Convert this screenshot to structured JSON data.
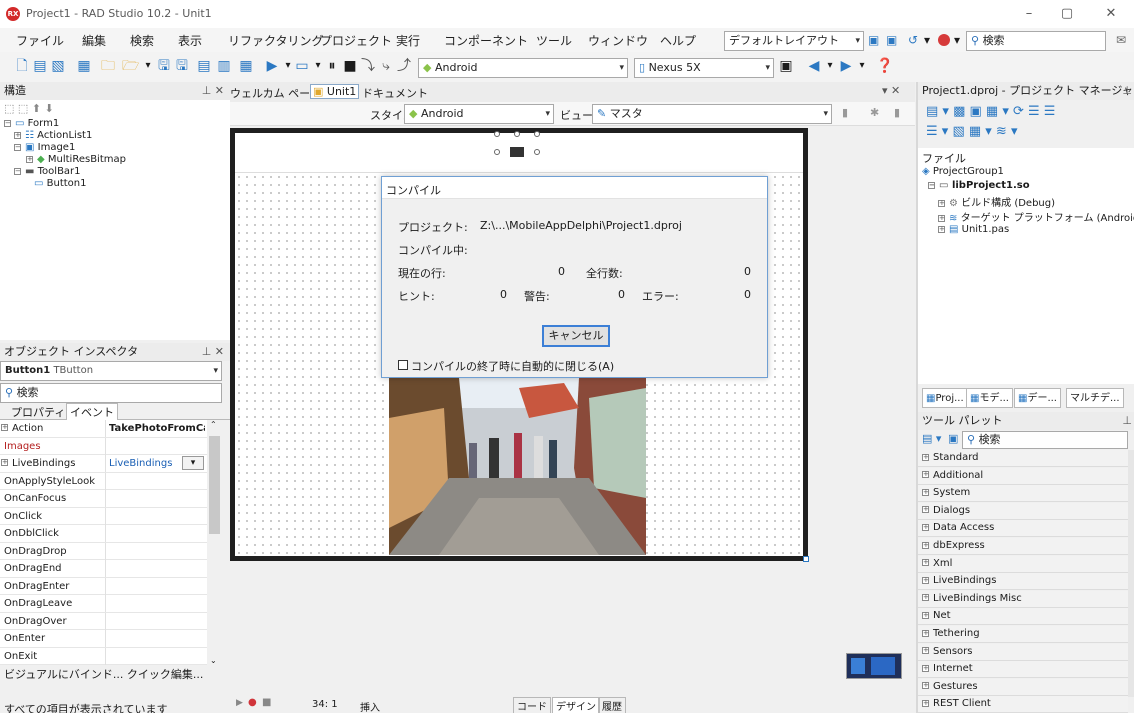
{
  "window": {
    "title": "Project1 - RAD Studio 10.2 - Unit1",
    "app_badge": "RX",
    "controls": {
      "minimize": "–",
      "restore": "▢",
      "close": "✕"
    }
  },
  "menu": {
    "items": [
      "ファイル",
      "編集",
      "検索",
      "表示",
      "リファクタリング",
      "プロジェクト",
      "実行",
      "コンポーネント",
      "ツール",
      "ウィンドウ",
      "ヘルプ"
    ],
    "layout_combo": "デフォルトレイアウト",
    "search_placeholder": "検索"
  },
  "toolbar": {
    "platform_combo": "Android",
    "device_combo": "Nexus 5X"
  },
  "structure": {
    "title": "構造",
    "tree": [
      {
        "label": "Form1",
        "level": 0
      },
      {
        "label": "ActionList1",
        "level": 1
      },
      {
        "label": "Image1",
        "level": 1
      },
      {
        "label": "MultiResBitmap",
        "level": 2
      },
      {
        "label": "ToolBar1",
        "level": 1
      },
      {
        "label": "Button1",
        "level": 2
      }
    ]
  },
  "inspector": {
    "title": "オブジェクト インスペクタ",
    "object_name": "Button1",
    "object_type": "TButton",
    "search_placeholder": "検索",
    "tab_properties": "プロパティ",
    "tab_events": "イベント",
    "rows": [
      {
        "name": "Action",
        "value": "TakePhotoFromCam",
        "expand": true,
        "bold_value": true
      },
      {
        "name": "Images",
        "value": "",
        "expand": false,
        "red": true
      },
      {
        "name": "LiveBindings",
        "value": "LiveBindings",
        "expand": true,
        "dropdown": true
      },
      {
        "name": "OnApplyStyleLook",
        "value": ""
      },
      {
        "name": "OnCanFocus",
        "value": ""
      },
      {
        "name": "OnClick",
        "value": ""
      },
      {
        "name": "OnDblClick",
        "value": ""
      },
      {
        "name": "OnDragDrop",
        "value": ""
      },
      {
        "name": "OnDragEnd",
        "value": ""
      },
      {
        "name": "OnDragEnter",
        "value": ""
      },
      {
        "name": "OnDragLeave",
        "value": ""
      },
      {
        "name": "OnDragOver",
        "value": ""
      },
      {
        "name": "OnEnter",
        "value": ""
      },
      {
        "name": "OnExit",
        "value": ""
      }
    ],
    "footer_links": "ビジュアルにバインド... クイック編集...",
    "status": "すべての項目が表示されています"
  },
  "editor": {
    "tabs": [
      "ウェルカム ページ",
      "Unit1",
      "ドキュメント"
    ],
    "style_label": "スタイル:",
    "style_value": "Android",
    "view_label": "ビュー:",
    "view_value": "マスタ",
    "bottom_tabs": [
      "コード",
      "デザイン",
      "履歴"
    ],
    "position": "34:  1",
    "mode": "挿入"
  },
  "compile_dialog": {
    "title": "コンパイル",
    "project_label": "プロジェクト:",
    "project_value": "Z:\\...\\MobileAppDelphi\\Project1.dproj",
    "status_label": "コンパイル中:",
    "current_line_label": "現在の行:",
    "current_line_value": "0",
    "total_lines_label": "全行数:",
    "total_lines_value": "0",
    "hints_label": "ヒント:",
    "hints_value": "0",
    "warnings_label": "警告:",
    "warnings_value": "0",
    "errors_label": "エラー:",
    "errors_value": "0",
    "cancel_button": "キャンセル",
    "auto_close_label": "コンパイルの終了時に自動的に閉じる(A)",
    "auto_close_checked": false
  },
  "project_manager": {
    "title": "Project1.dproj - プロジェクト マネージャ",
    "file_label": "ファイル",
    "tree": [
      {
        "label": "ProjectGroup1",
        "level": 0,
        "bold": false
      },
      {
        "label": "libProject1.so",
        "level": 1,
        "bold": true
      },
      {
        "label": "ビルド構成 (Debug)",
        "level": 2,
        "bold": false
      },
      {
        "label": "ターゲット プラットフォーム (Android)",
        "level": 2,
        "bold": false
      },
      {
        "label": "Unit1.pas",
        "level": 2,
        "bold": false
      }
    ],
    "bottom_tabs": [
      "Proj...",
      "モデ...",
      "デー...",
      "マルチデ..."
    ]
  },
  "tool_palette": {
    "title": "ツール パレット",
    "search_placeholder": "検索",
    "categories": [
      "Standard",
      "Additional",
      "System",
      "Dialogs",
      "Data Access",
      "dbExpress",
      "Xml",
      "LiveBindings",
      "LiveBindings Misc",
      "Net",
      "Tethering",
      "Sensors",
      "Internet",
      "Gestures",
      "REST Client"
    ]
  },
  "colors": {
    "accent": "#2b78c2",
    "android_green": "#8bc34a",
    "selection": "#cde6f7",
    "device_frame": "#1f1f1f"
  }
}
